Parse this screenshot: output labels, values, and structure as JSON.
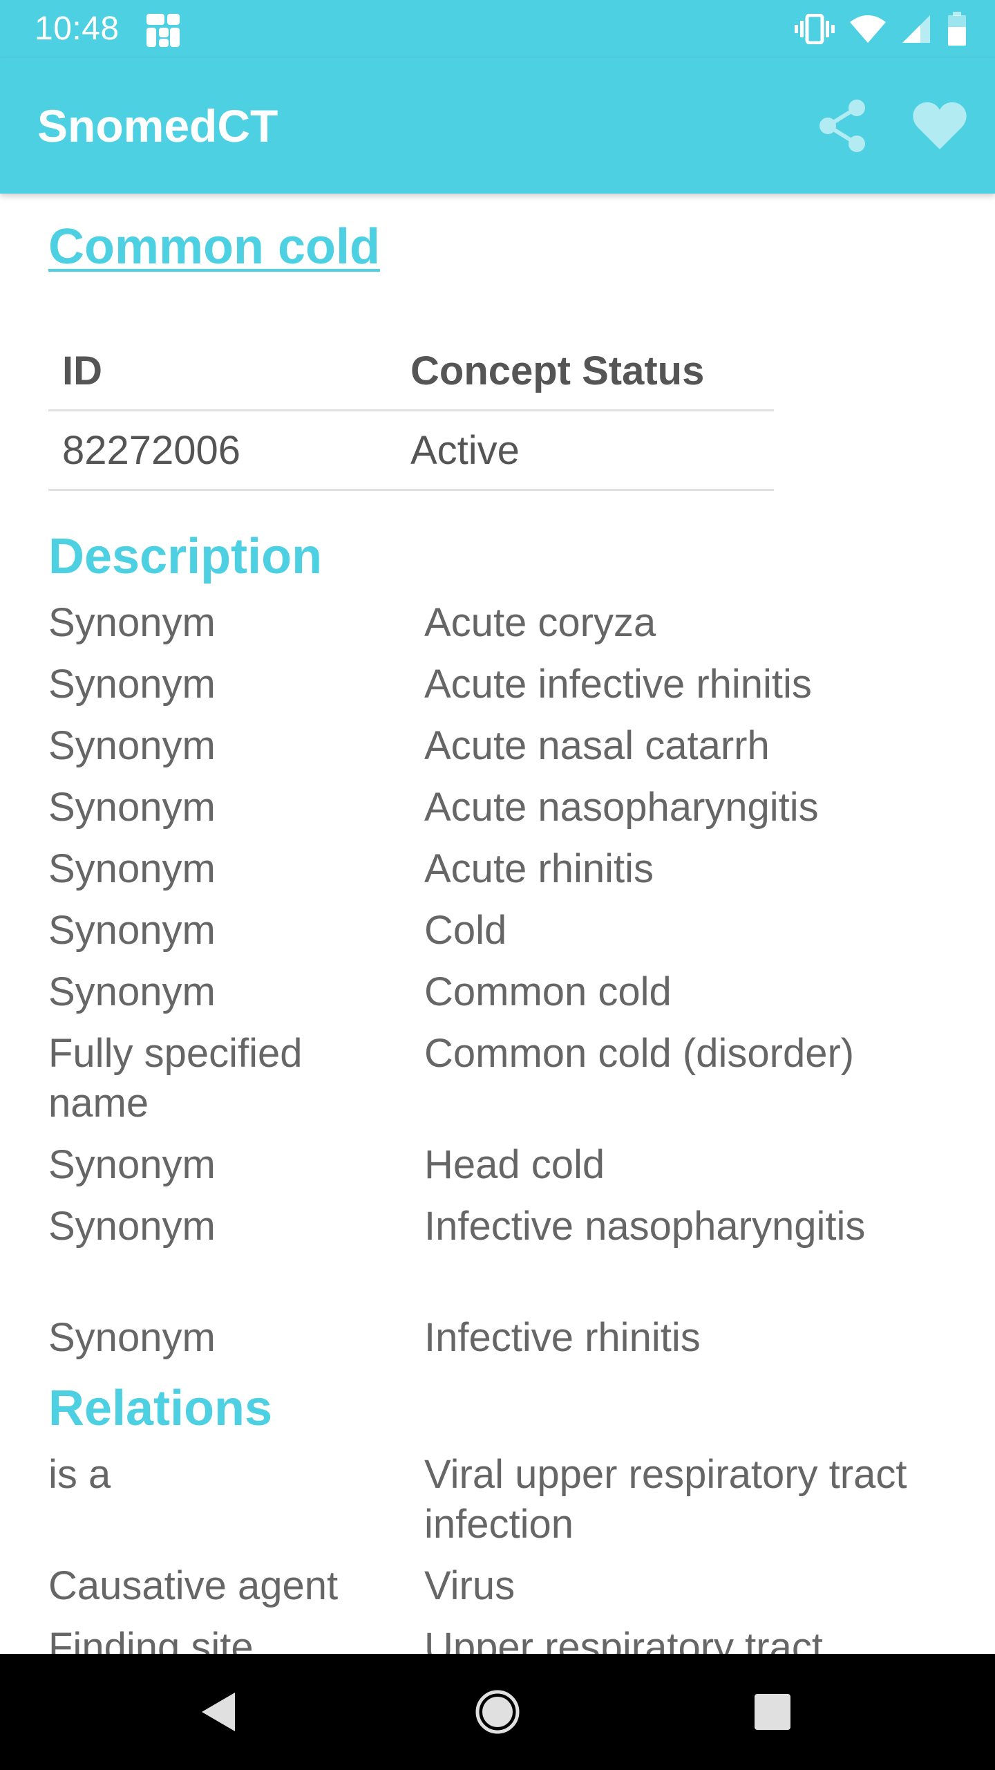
{
  "status_bar": {
    "time": "10:48",
    "icons": [
      "app-notification-icon",
      "vibrate-icon",
      "wifi-icon",
      "cell-signal-icon",
      "battery-icon"
    ]
  },
  "app_bar": {
    "title": "SnomedCT",
    "actions": [
      "share-icon",
      "favorite-heart-icon"
    ]
  },
  "concept": {
    "title": "Common cold",
    "table": {
      "headers": [
        "ID",
        "Concept Status"
      ],
      "row": [
        "82272006",
        "Active"
      ]
    }
  },
  "description": {
    "heading": "Description",
    "rows": [
      {
        "type": "Synonym",
        "term": "Acute coryza"
      },
      {
        "type": "Synonym",
        "term": "Acute infective rhinitis"
      },
      {
        "type": "Synonym",
        "term": "Acute nasal catarrh"
      },
      {
        "type": "Synonym",
        "term": "Acute nasopharyngitis"
      },
      {
        "type": "Synonym",
        "term": "Acute rhinitis"
      },
      {
        "type": "Synonym",
        "term": "Cold"
      },
      {
        "type": "Synonym",
        "term": "Common cold"
      },
      {
        "type": "Fully specified name",
        "term": "Common cold (disorder)"
      },
      {
        "type": "Synonym",
        "term": "Head cold"
      },
      {
        "type": "Synonym",
        "term": "Infective nasopharyngitis"
      },
      {
        "type": "Synonym",
        "term": "Infective rhinitis"
      }
    ]
  },
  "relations": {
    "heading": "Relations",
    "rows": [
      {
        "type": "is a",
        "target": "Viral upper respiratory tract infection"
      },
      {
        "type": "Causative agent",
        "target": "Virus"
      },
      {
        "type": "Finding site",
        "target": "Upper respiratory tract"
      }
    ]
  },
  "nav_bar": {
    "buttons": [
      "back-icon",
      "home-icon",
      "recents-icon"
    ]
  },
  "colors": {
    "accent": "#4dd0e1",
    "text": "#666666",
    "divider": "#e0e0e0",
    "nav_bg": "#000000"
  }
}
